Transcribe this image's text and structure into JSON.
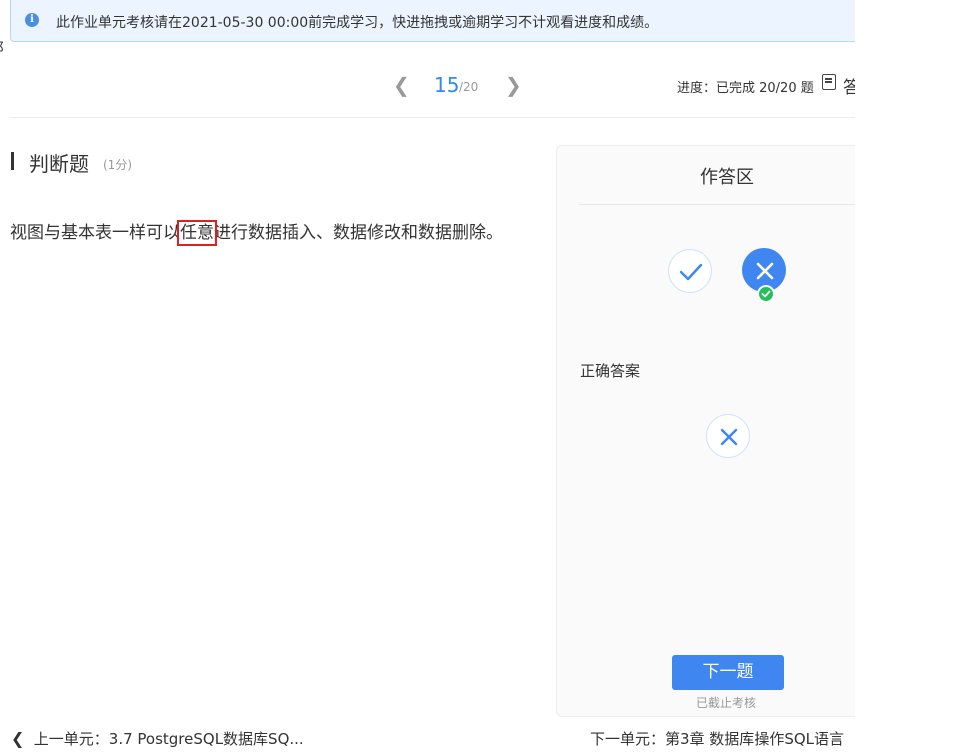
{
  "notice": {
    "icon": "info-icon",
    "text": "此作业单元考核请在2021-05-30 00:00前完成学习，快进拖拽或逾期学习不计观看进度和成绩。"
  },
  "pager": {
    "current": "15",
    "total": "/20",
    "prev_icon": "chevron-left-icon",
    "next_icon": "chevron-right-icon"
  },
  "progress": {
    "text": "进度：已完成 20/20 题",
    "answer_card_icon": "answer-card-icon",
    "answer_card_label": "答"
  },
  "question": {
    "type": "判断题",
    "score": "(1分)",
    "text_before": "视图与基本表一样可以",
    "text_highlight": "任意",
    "text_after": "进行数据插入、数据修改和数据删除。"
  },
  "answer_panel": {
    "title": "作答区",
    "options": [
      {
        "name": "true",
        "icon": "check-icon",
        "selected": false
      },
      {
        "name": "false",
        "icon": "cross-icon",
        "selected": true
      }
    ],
    "selected_badge_icon": "check-badge-icon",
    "correct_label": "正确答案",
    "correct_icon": "cross-icon",
    "next_button": "下一题",
    "deadline_text": "已截止考核"
  },
  "bottom_nav": {
    "prev_label": "上一单元：3.7 PostgreSQL数据库SQ...",
    "next_label": "下一单元：第3章 数据库操作SQL语言"
  },
  "colors": {
    "accent": "#3f86f0",
    "success": "#21c05a",
    "highlight_box": "#e02020",
    "notice_bg": "#ecf5ff"
  }
}
